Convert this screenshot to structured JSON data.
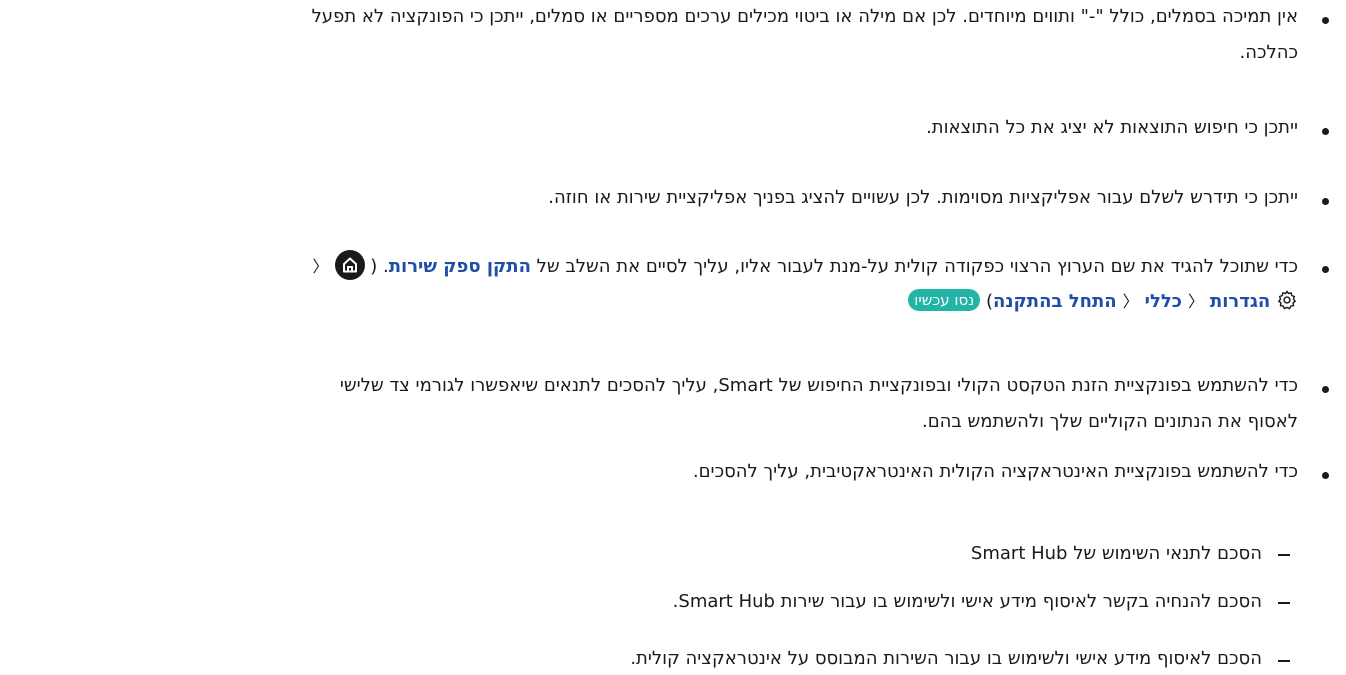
{
  "bullets": {
    "b1_line1": "אין תמיכה בסמלים, כולל \"-\" ותווים מיוחדים. לכן אם מילה או ביטוי מכילים ערכים מספריים או סמלים, ייתכן כי הפונקציה לא תפעל",
    "b1_line2": "כהלכה.",
    "b2": "ייתכן כי חיפוש התוצאות לא יציג את כל התוצאות.",
    "b3": "ייתכן כי תידרש לשלם עבור אפליקציות מסוימות. לכן עשויים להציג בפניך אפליקציית שירות או חוזה.",
    "b4_prefix": "כדי שתוכל להגיד את שם הערוץ הרצוי כפקודה קולית על-מנת לעבור אליו, עליך לסיים את השלב של ",
    "b4_link": "התקן ספק שירות",
    "b4_after_link": ". (",
    "b4_path_settings": "הגדרות",
    "b4_path_general": "כללי",
    "b4_path_start_setup": "התחל בהתקנה",
    "b4_close_paren": ")",
    "b4_badge": "נסו עכשיו",
    "b5_line1": "כדי להשתמש בפונקציית הזנת הטקסט הקולי ובפונקציית החיפוש של Smart, עליך להסכים לתנאים שיאפשרו לגורמי צד שלישי",
    "b5_line2": "לאסוף את הנתונים הקוליים שלך ולהשתמש בהם.",
    "b6": "כדי להשתמש בפונקציית האינטראקציה הקולית האינטראקטיבית, עליך להסכים."
  },
  "sub_items": [
    "הסכם לתנאי השימוש של Smart Hub",
    "הסכם להנחיה בקשר לאיסוף מידע אישי ולשימוש בו עבור שירות Smart Hub.",
    "הסכם לאיסוף מידע אישי ולשימוש בו עבור השירות המבוסס על אינטראקציה קולית."
  ],
  "colors": {
    "link": "#1f4ea8",
    "badge": "#22b4a6",
    "text": "#1a1a1a"
  },
  "icons": {
    "home": "home-icon",
    "settings": "gear-icon",
    "separator": "chevron-left-icon"
  }
}
